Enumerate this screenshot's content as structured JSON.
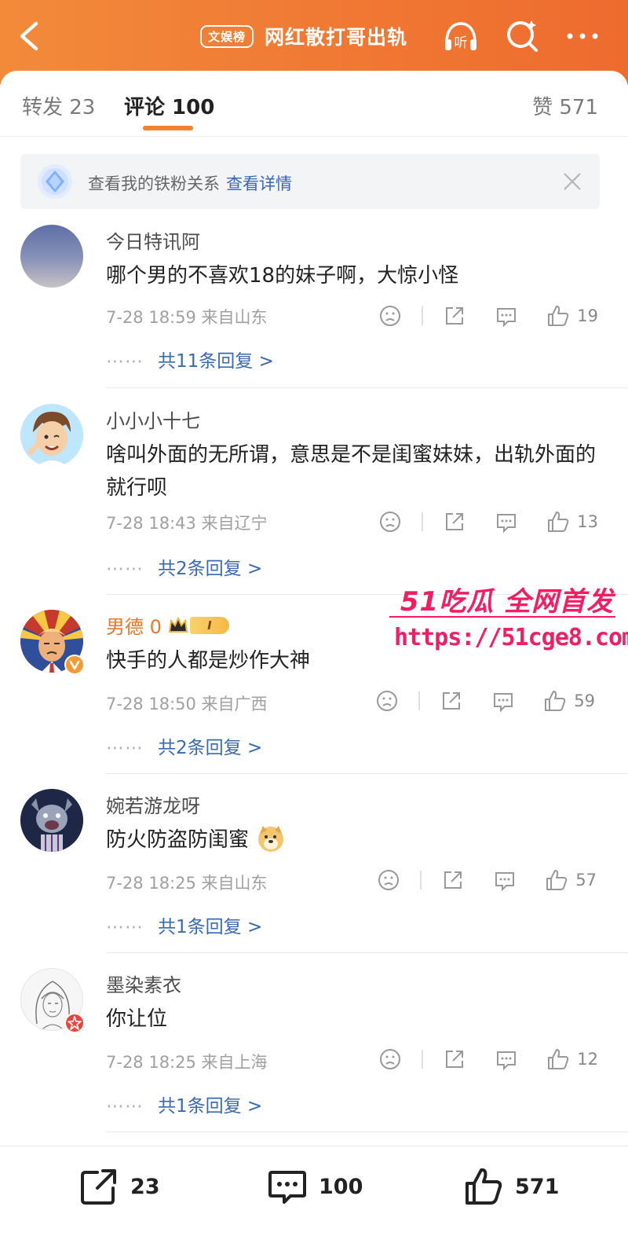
{
  "header": {
    "tag": "文娱榜",
    "title": "网红散打哥出轨",
    "colors": {
      "start": "#f28a3a",
      "end": "#ee6b2e"
    }
  },
  "tabs": {
    "repost": "转发 23",
    "comment": "评论 100",
    "like": "赞 571"
  },
  "fans_banner": {
    "text": "查看我的铁粉关系",
    "link": "查看详情"
  },
  "comments": [
    {
      "user": "今日特讯阿",
      "text": "哪个男的不喜欢18的妹子啊，大惊小怪",
      "time": "7-28 18:59 来自山东",
      "likes": "19",
      "replies": "共11条回复 >"
    },
    {
      "user": "小小小十七",
      "text": "啥叫外面的无所谓，意思是不是闺蜜妹妹，出轨外面的就行呗",
      "time": "7-28 18:43 来自辽宁",
      "likes": "13",
      "replies": "共2条回复 >"
    },
    {
      "user": "男德 0",
      "text": "快手的人都是炒作大神",
      "time": "7-28 18:50 来自广西",
      "likes": "59",
      "replies": "共2条回复 >",
      "vip_badge": "I"
    },
    {
      "user": "婉若游龙呀",
      "text": "防火防盗防闺蜜",
      "time": "7-28 18:25 来自山东",
      "likes": "57",
      "replies": "共1条回复 >"
    },
    {
      "user": "墨染素衣",
      "text": "你让位",
      "time": "7-28 18:25 来自上海",
      "likes": "12",
      "replies": "共1条回复 >"
    }
  ],
  "reply_dots": "⋯⋯",
  "watermark": {
    "line1": "51吃瓜 全网首发",
    "url": "https://51cge8.com"
  },
  "bottom_bar": {
    "repost": "23",
    "comment": "100",
    "like": "571"
  }
}
